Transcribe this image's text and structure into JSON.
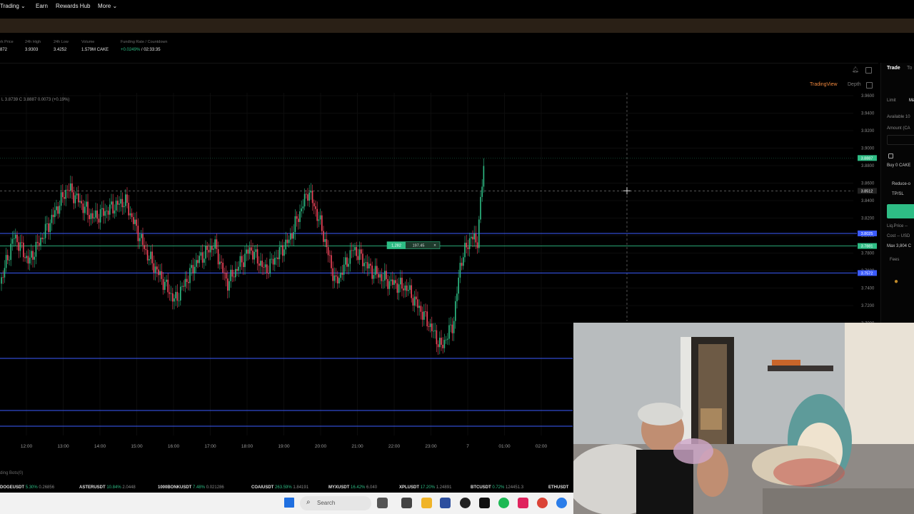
{
  "nav": {
    "items": [
      "Trading",
      "Earn",
      "Rewards Hub",
      "More"
    ]
  },
  "stats": [
    {
      "label": "rk Price",
      "value": "872"
    },
    {
      "label": "24h High",
      "value": "3.9303"
    },
    {
      "label": "24h Low",
      "value": "3.4252"
    },
    {
      "label": "Volume",
      "value": "1.579M CAKE"
    },
    {
      "label": "Funding Rate / Countdown",
      "value": "+0.0249%",
      "value2": "/ 02:33:35"
    }
  ],
  "chart": {
    "ohlc": "L 3.8739  C 3.8887  0.0073 (+0.19%)",
    "tabs": [
      "TradingView",
      "Depth"
    ],
    "price_ticks": [
      "3.9600",
      "3.9400",
      "3.9200",
      "3.9000",
      "3.8800",
      "3.8600",
      "3.8400",
      "3.8200",
      "3.8000",
      "3.7800",
      "3.7600",
      "3.7400",
      "3.7200",
      "3.7000"
    ],
    "price_labels": {
      "last": "3.8887",
      "crosshair": "3.8512",
      "level_blue_1": "3.8025",
      "level_green": "3.7881",
      "level_blue_2": "3.7572"
    },
    "order_tag": {
      "qty": "1,282",
      "price": "197.45",
      "close": "×"
    },
    "time_ticks": [
      "12:00",
      "13:00",
      "14:00",
      "15:00",
      "16:00",
      "17:00",
      "18:00",
      "19:00",
      "20:00",
      "21:00",
      "22:00",
      "23:00",
      "7",
      "01:00",
      "02:00"
    ]
  },
  "right_panel": {
    "tabs": [
      "Trade",
      "To"
    ],
    "order_types": [
      "Limit",
      "Ma"
    ],
    "available": "Available  10",
    "amount": "Amount (CA",
    "buy": "Buy  0 CAKE",
    "reduce": "Reduce-o",
    "tpsl": "TP/SL",
    "liq": "Liq.Price  --",
    "cost": "Cost  --  USD",
    "max": "Max  3,804 C",
    "fees": "Fees"
  },
  "bots_label": "ding Bots(0)",
  "tickers": [
    {
      "symbol": "DOGEUSDT",
      "change": "5.30%",
      "price": "0.26856"
    },
    {
      "symbol": "ASTERUSDT",
      "change": "10.84%",
      "price": "2.0448"
    },
    {
      "symbol": "1000BONKUSDT",
      "change": "7.48%",
      "price": "0.021286"
    },
    {
      "symbol": "COAIUSDT",
      "change": "263.59%",
      "price": "1.84191"
    },
    {
      "symbol": "MYXUSDT",
      "change": "16.42%",
      "price": "6.040"
    },
    {
      "symbol": "XPLUSDT",
      "change": "17.20%",
      "price": "1.24891"
    },
    {
      "symbol": "BTCUSDT",
      "change": "0.72%",
      "price": "124451.3"
    },
    {
      "symbol": "ETHUSDT",
      "change": "",
      "price": ""
    }
  ],
  "taskbar": {
    "search_placeholder": "Search"
  },
  "colors": {
    "up": "#2ebd85",
    "down": "#f6465d",
    "level_blue": "#3b5bff",
    "level_green": "#2ebd85",
    "accent": "#f0883e"
  }
}
